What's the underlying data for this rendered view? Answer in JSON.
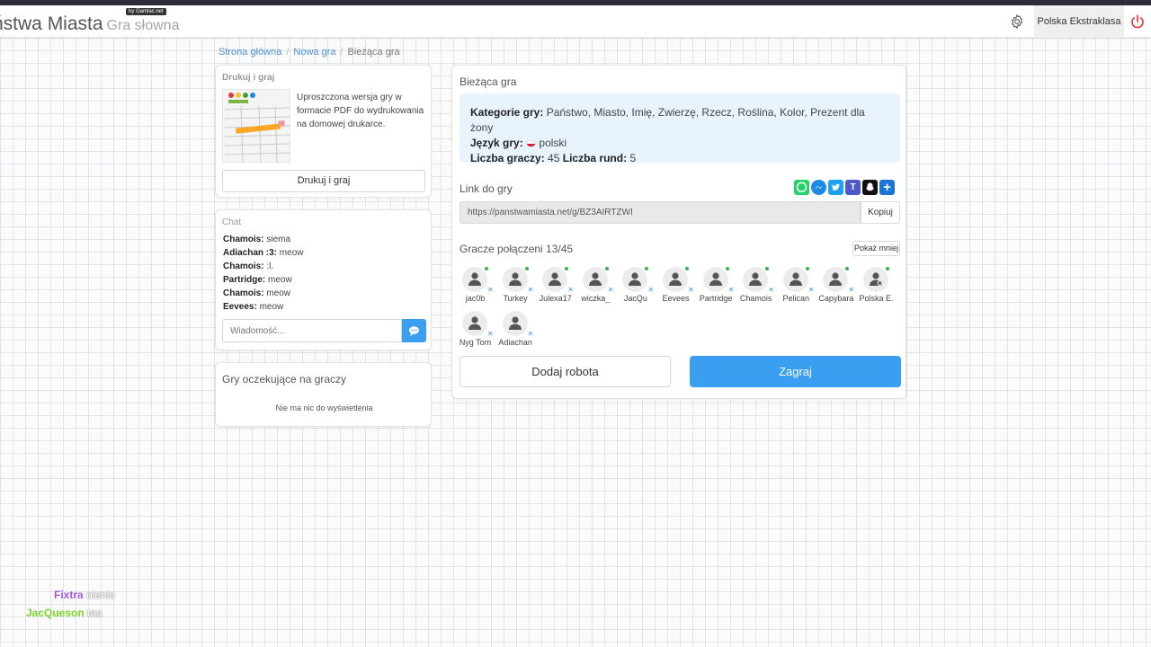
{
  "header": {
    "logo_main": "ństwa Miasta",
    "logo_sub": "Gra słowna",
    "logo_badge": "by Gamlac.net",
    "user_name": "Polska Ekstraklasa",
    "settings_icon": "gear-icon",
    "logout_icon": "power-icon"
  },
  "breadcrumb": {
    "home": "Strona główna",
    "new_game": "Nowa gra",
    "current": "Bieżąca gra"
  },
  "print_card": {
    "title": "Drukuj i graj",
    "description": "Uproszczona wersja gry w formacie PDF do wydrukowania na domowej drukarce.",
    "button": "Drukuj i graj"
  },
  "chat": {
    "title": "Chat",
    "messages": [
      {
        "user": "Chamois:",
        "text": "siema"
      },
      {
        "user": "Adiachan :3:",
        "text": "meow"
      },
      {
        "user": "Chamois:",
        "text": ":l."
      },
      {
        "user": "Partridge:",
        "text": "meow"
      },
      {
        "user": "Chamois:",
        "text": "meow"
      },
      {
        "user": "Eevees:",
        "text": "meow"
      }
    ],
    "input_placeholder": "Wiadomość...",
    "send_icon": "speech-bubble-icon"
  },
  "waiting_games": {
    "title": "Gry oczekujące na graczy",
    "empty": "Nie ma nic do wyświetlenia"
  },
  "game": {
    "title": "Bieżąca gra",
    "categories_label": "Kategorie gry:",
    "categories_value": "Państwo, Miasto, Imię, Zwierzę, Rzecz, Roślina, Kolor, Prezent dla żony",
    "language_label": "Język gry:",
    "language_value": "polski",
    "players_count_label": "Liczba graczy:",
    "players_count_value": "45",
    "rounds_label": "Liczba rund:",
    "rounds_value": "5",
    "link_label": "Link do gry",
    "link_value": "https://panstwamiasta.net/g/BZ3AIRTZWI",
    "copy_button": "Kopiuj",
    "share_icons": [
      "whatsapp-icon",
      "messenger-icon",
      "twitter-icon",
      "teams-icon",
      "snapchat-icon",
      "add-share-icon"
    ],
    "share_colors": [
      "#25d366",
      "#1e88e5",
      "#1da1f2",
      "#5059c9",
      "#111111",
      "#1976d2"
    ],
    "connected_label": "Gracze połączeni 13/45",
    "show_less_button": "Pokaż mniej",
    "players": [
      "jac0b",
      "Turkey",
      "Julexa17",
      "wiczka_",
      "JacQu",
      "Eevees",
      "Partridge",
      "Chamois",
      "Pelican",
      "Capybara",
      "Polska E.",
      "Nyg Tom",
      "Adiachan"
    ],
    "add_robot_button": "Dodaj robota",
    "play_button": "Zagraj"
  },
  "stream_overlay": [
    {
      "user": "Fixtra",
      "text": "nienie",
      "color": "#a558e0"
    },
    {
      "user": "JacQueson",
      "text": "taa",
      "color": "#7dd62a"
    }
  ]
}
